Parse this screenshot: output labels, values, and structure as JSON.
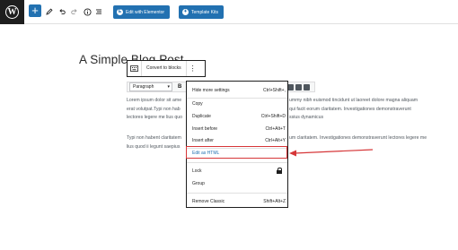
{
  "toolbar": {
    "add_label": "+",
    "elementor_btn": "Edit with Elementor",
    "template_kits_btn": "Template Kits",
    "elementor_badge": "E",
    "kits_badge": "✦"
  },
  "editor": {
    "post_title": "A Simple Blog Post",
    "block_toolbar": {
      "label": "Convert to blocks",
      "more_icon": "⋮"
    },
    "classic_toolbar": {
      "format_value": "Paragraph",
      "bold_label": "B"
    },
    "paragraph_1_left": [
      "Lorem ipsum dolor sit ame",
      "erat volutpat.Typi non hab",
      "lectores legere me lius quo"
    ],
    "paragraph_1_right": [
      "ummy nibh euismod tincidunt ut laoreet dolore magna aliquam",
      "qui facit eorum claritatem. Investigationes demonstraverunt",
      "ssius dynamicus"
    ],
    "paragraph_2_left": [
      "Typi non habent claritatem",
      "lius quod ii legunt saepius"
    ],
    "paragraph_2_right": [
      "um claritatem. Investigationes demonstraverunt lectores legere me",
      ""
    ]
  },
  "menu": {
    "items": [
      {
        "label": "Hide more settings",
        "shortcut": "Ctrl+Shift+,"
      },
      {
        "label": "Copy",
        "shortcut": ""
      },
      {
        "label": "Duplicate",
        "shortcut": "Ctrl+Shift+D"
      },
      {
        "label": "Insert before",
        "shortcut": "Ctrl+Alt+T"
      },
      {
        "label": "Insert after",
        "shortcut": "Ctrl+Alt+Y"
      },
      {
        "label": "Edit as HTML",
        "shortcut": ""
      },
      {
        "label": "Lock",
        "shortcut": ""
      },
      {
        "label": "Group",
        "shortcut": ""
      },
      {
        "label": "Remove Classic",
        "shortcut": "Shift+Alt+Z"
      }
    ]
  },
  "colors": {
    "accent": "#2271b1",
    "highlight": "#d63638"
  }
}
